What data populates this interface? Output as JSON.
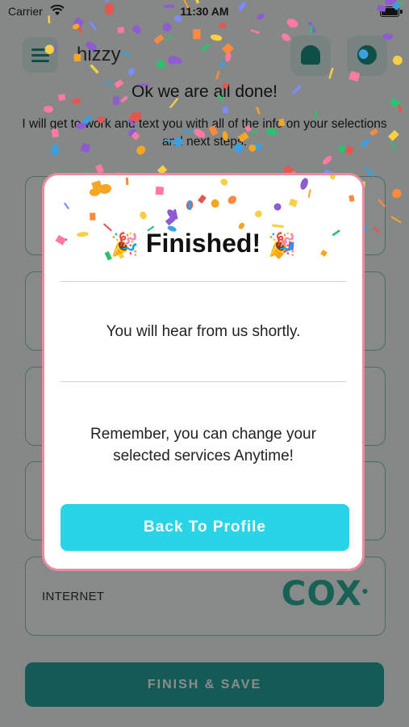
{
  "status_bar": {
    "carrier": "Carrier",
    "time": "11:30 AM"
  },
  "header": {
    "logo_text": "hizzy"
  },
  "intro": {
    "title": "Ok we are all done!",
    "text": "I will get to work and text you with all of the info on your selections and next steps."
  },
  "cards": [
    {
      "label": ""
    },
    {
      "label": ""
    },
    {
      "label": ""
    },
    {
      "label": ""
    },
    {
      "label": "INTERNET",
      "brand": "COX"
    }
  ],
  "finish_button": {
    "label": "FINISH & SAVE"
  },
  "modal": {
    "emoji": "🎉",
    "title": "Finished!",
    "message": "You will hear from us shortly.",
    "note": "Remember, you can change your selected services Anytime!",
    "button_label": "Back To Profile"
  },
  "colors": {
    "accent_teal": "#25a6a0",
    "modal_border": "#e88c9f",
    "button_cyan": "#29d4e6",
    "cox_blue": "#0a7aa3",
    "cox_green": "#2bb39c"
  },
  "icons": [
    "wifi-icon",
    "battery-icon",
    "menu-icon",
    "bell-icon",
    "chat-icon",
    "party-popper-icon"
  ]
}
